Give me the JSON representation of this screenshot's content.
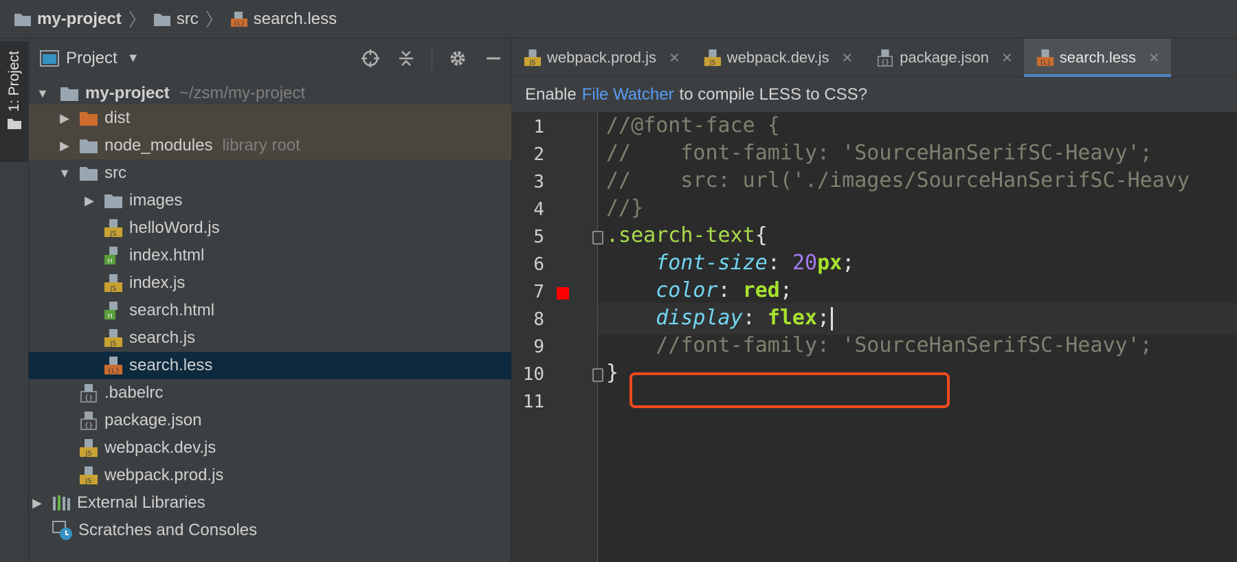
{
  "breadcrumb": [
    {
      "label": "my-project",
      "icon": "folder-icon"
    },
    {
      "label": "src",
      "icon": "folder-icon"
    },
    {
      "label": "search.less",
      "icon": "less-file-icon"
    }
  ],
  "toolstrip": {
    "project_tab": "1: Project"
  },
  "project_panel": {
    "title": "Project",
    "tree": [
      {
        "label": "my-project",
        "hint": "~/zsm/my-project",
        "type": "folder",
        "expanded": true,
        "depth": 0
      },
      {
        "label": "dist",
        "type": "folder-excluded",
        "expanded": false,
        "depth": 1
      },
      {
        "label": "node_modules",
        "hint": "library root",
        "type": "folder",
        "expanded": false,
        "depth": 1
      },
      {
        "label": "src",
        "type": "folder",
        "expanded": true,
        "depth": 1
      },
      {
        "label": "images",
        "type": "folder",
        "expanded": false,
        "depth": 2
      },
      {
        "label": "helloWord.js",
        "type": "js",
        "depth": 2
      },
      {
        "label": "index.html",
        "type": "html",
        "depth": 2
      },
      {
        "label": "index.js",
        "type": "js",
        "depth": 2
      },
      {
        "label": "search.html",
        "type": "html",
        "depth": 2
      },
      {
        "label": "search.js",
        "type": "js",
        "depth": 2
      },
      {
        "label": "search.less",
        "type": "less",
        "depth": 2
      },
      {
        "label": ".babelrc",
        "type": "json",
        "depth": 1
      },
      {
        "label": "package.json",
        "type": "json",
        "depth": 1
      },
      {
        "label": "webpack.dev.js",
        "type": "js",
        "depth": 1
      },
      {
        "label": "webpack.prod.js",
        "type": "js",
        "depth": 1
      },
      {
        "label": "External Libraries",
        "type": "libraries",
        "expanded": false,
        "depth": 0
      },
      {
        "label": "Scratches and Consoles",
        "type": "scratches",
        "depth": 0
      }
    ]
  },
  "tabs": [
    {
      "label": "webpack.prod.js",
      "type": "js"
    },
    {
      "label": "webpack.dev.js",
      "type": "js"
    },
    {
      "label": "package.json",
      "type": "json"
    },
    {
      "label": "search.less",
      "type": "less",
      "active": true
    }
  ],
  "banner": {
    "prefix": "Enable",
    "link": "File Watcher",
    "suffix": "to compile LESS to CSS?"
  },
  "code": {
    "line_numbers": [
      "1",
      "2",
      "3",
      "4",
      "5",
      "6",
      "7",
      "8",
      "9",
      "10",
      "11"
    ],
    "lines": [
      [
        {
          "t": "//@font-face {",
          "c": "c-comment"
        }
      ],
      [
        {
          "t": "//    font-family: 'SourceHanSerifSC-Heavy';",
          "c": "c-comment"
        }
      ],
      [
        {
          "t": "//    src: url('./images/SourceHanSerifSC-Heavy",
          "c": "c-comment"
        }
      ],
      [
        {
          "t": "//}",
          "c": "c-comment"
        }
      ],
      [
        {
          "t": ".search-text",
          "c": "c-selector"
        },
        {
          "t": "{",
          "c": "c-punc"
        }
      ],
      [
        {
          "t": "    "
        },
        {
          "t": "font-size",
          "c": "c-prop"
        },
        {
          "t": ": ",
          "c": "c-punc"
        },
        {
          "t": "20",
          "c": "c-num"
        },
        {
          "t": "px",
          "c": "c-val"
        },
        {
          "t": ";",
          "c": "c-punc"
        }
      ],
      [
        {
          "t": "    "
        },
        {
          "t": "color",
          "c": "c-prop"
        },
        {
          "t": ": ",
          "c": "c-punc"
        },
        {
          "t": "red",
          "c": "c-val"
        },
        {
          "t": ";",
          "c": "c-punc"
        }
      ],
      [
        {
          "t": "    "
        },
        {
          "t": "display",
          "c": "c-prop"
        },
        {
          "t": ": ",
          "c": "c-punc"
        },
        {
          "t": "flex",
          "c": "c-val"
        },
        {
          "t": ";",
          "c": "c-punc"
        }
      ],
      [
        {
          "t": "    //font-family: 'SourceHanSerifSC-Heavy';",
          "c": "c-comment"
        }
      ],
      [
        {
          "t": "}",
          "c": "c-punc"
        }
      ],
      []
    ],
    "current_line": 8,
    "color_swatch_line": 7,
    "color_swatch": "#ff0000",
    "fold_lines": [
      5,
      10
    ]
  },
  "colors": {
    "accent": "#4a88c7",
    "highlight_box": "#f24a1d",
    "selected_row": "#0d293e"
  }
}
